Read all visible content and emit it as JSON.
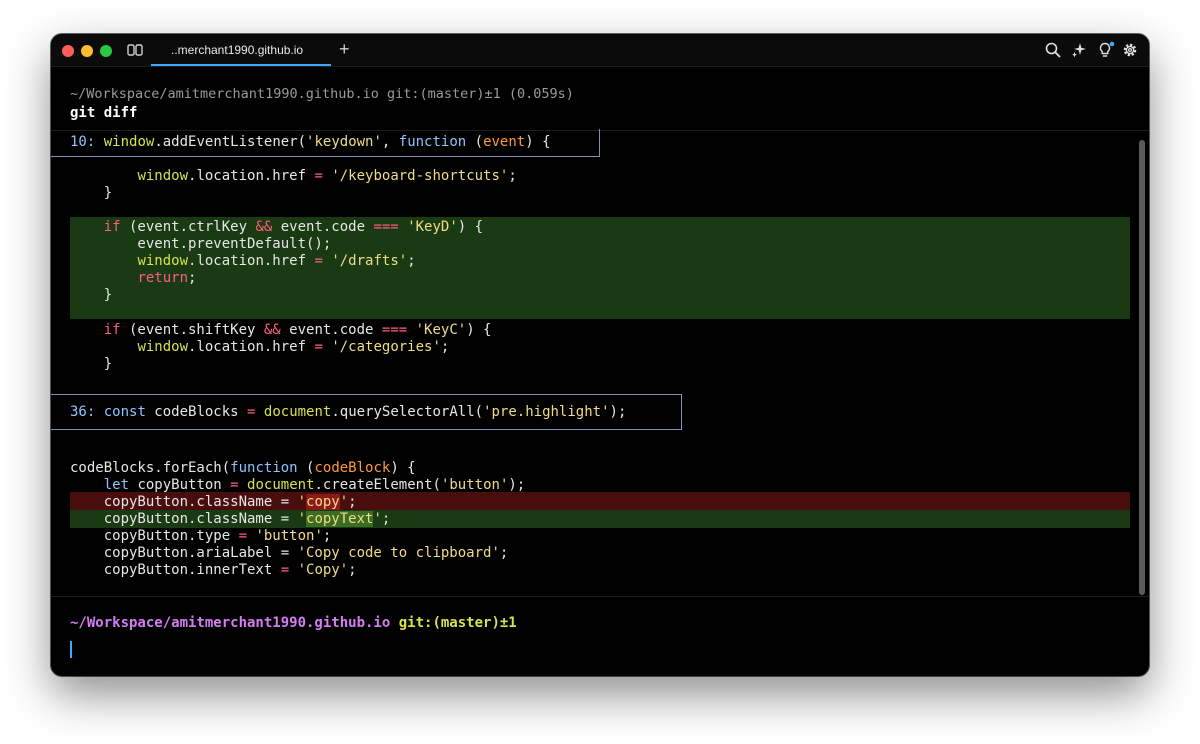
{
  "window": {
    "tab_title": "..merchant1990.github.io",
    "new_tab": "+"
  },
  "toolbar_icons": [
    "sidebar-icon",
    "search-icon",
    "sparkle-icon",
    "lightbulb-icon",
    "gear-icon"
  ],
  "block": {
    "meta": "~/Workspace/amitmerchant1990.github.io git:(master)±1 (0.059s)",
    "command": "git diff"
  },
  "diff": {
    "hunk1": {
      "num": "10:",
      "w1": "window",
      "p1": ".",
      "f1": "addEventListener",
      "p2": "(",
      "s1": "'keydown'",
      "p3": ", ",
      "k1": "function",
      "p4": " (",
      "v1": "event",
      "p5": ") {"
    },
    "l1": {
      "ind": "        ",
      "w": "window",
      "rest": ".location.href ",
      "op": "=",
      "sp": " ",
      "str": "'/keyboard-shortcuts'",
      "end": ";"
    },
    "l2": {
      "text": "    }"
    },
    "l3": {
      "ind": "    ",
      "kw": "if",
      "a": " (event.ctrlKey ",
      "op1": "&&",
      "b": " event.code ",
      "op2": "===",
      "sp": " ",
      "str": "'KeyD'",
      "end": ") {"
    },
    "l4": {
      "text": "        event.preventDefault();"
    },
    "l5": {
      "ind": "        ",
      "w": "window",
      "rest": ".location.href ",
      "op": "=",
      "sp": " ",
      "str": "'/drafts'",
      "end": ";"
    },
    "l6": {
      "ind": "        ",
      "kw": "return",
      "end": ";"
    },
    "l7": {
      "text": "    }"
    },
    "l8": {
      "ind": "    ",
      "kw": "if",
      "a": " (event.shiftKey ",
      "op1": "&&",
      "b": " event.code ",
      "op2": "===",
      "sp": " ",
      "str": "'KeyC'",
      "end": ") {"
    },
    "l9": {
      "ind": "        ",
      "w": "window",
      "rest": ".location.href ",
      "op": "=",
      "sp": " ",
      "str": "'/categories'",
      "end": ";"
    },
    "l10": {
      "text": "    }"
    },
    "hunk2": {
      "num": "36:",
      "k1": " const",
      "p1": " codeBlocks ",
      "op": "=",
      "sp": " ",
      "w": "document",
      "p2": ".",
      "f": "querySelectorAll",
      "p3": "(",
      "s": "'pre.highlight'",
      "p4": ");"
    },
    "l11": {
      "a": "codeBlocks.",
      "f": "forEach",
      "b": "(",
      "kw": "function",
      "c": " (",
      "v": "codeBlock",
      "d": ") {"
    },
    "l12": {
      "ind": "    ",
      "kw": "let",
      "a": " copyButton ",
      "op": "=",
      "sp": " ",
      "w": "document",
      "b": ".",
      "f": "createElement",
      "c": "(",
      "s": "'button'",
      "d": ");"
    },
    "l13": {
      "a": "    copyButton.className = ",
      "q1": "'",
      "hl": "copy",
      "q2": "'",
      "end": ";"
    },
    "l14": {
      "a": "    copyButton.className = ",
      "q1": "'",
      "hl": "copyText",
      "q2": "'",
      "end": ";"
    },
    "l15": {
      "a": "    copyButton.type ",
      "op": "=",
      "sp": " ",
      "s": "'button'",
      "end": ";"
    },
    "l16": {
      "a": "    copyButton.ariaLabel = ",
      "s": "'Copy code to clipboard'",
      "end": ";"
    },
    "l17": {
      "a": "    copyButton.innerText ",
      "op": "=",
      "sp": " ",
      "s": "'Copy'",
      "end": ";"
    }
  },
  "prompt": {
    "path": "~/Workspace/amitmerchant1990.github.io",
    "git": " git:(master)±1"
  },
  "colors": {
    "tab_accent": "#3ea8ff",
    "added_bg": "#1a3a14",
    "removed_bg": "#4a0d0d",
    "path": "#d47cf2",
    "git": "#d8e24a"
  }
}
